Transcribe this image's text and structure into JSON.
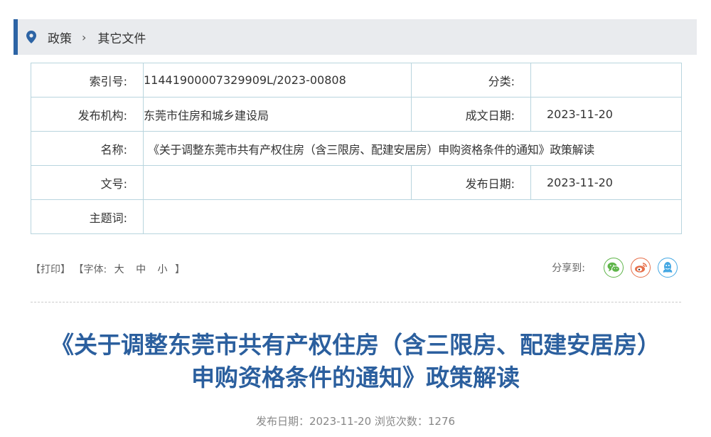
{
  "breadcrumb": {
    "items": [
      "政策",
      "其它文件"
    ],
    "separator": "›"
  },
  "meta": {
    "index_label": "索引号:",
    "index_value": "11441900007329909L/2023-00808",
    "category_label": "分类:",
    "category_value": "",
    "publisher_label": "发布机构:",
    "publisher_value": "东莞市住房和城乡建设局",
    "written_date_label": "成文日期:",
    "written_date_value": "2023-11-20",
    "name_label": "名称:",
    "name_value": "《关于调整东莞市共有产权住房（含三限房、配建安居房）申购资格条件的通知》政策解读",
    "doc_no_label": "文号:",
    "doc_no_value": "",
    "publish_date_label": "发布日期:",
    "publish_date_value": "2023-11-20",
    "subject_label": "主题词:",
    "subject_value": ""
  },
  "toolbar": {
    "print": "【打印】",
    "font_prefix": "【字体:",
    "font_large": "大",
    "font_medium": "中",
    "font_small": "小",
    "font_suffix": "】",
    "share_label": "分享到:",
    "share_icons": [
      "wechat-icon",
      "weibo-icon",
      "qq-icon"
    ]
  },
  "article": {
    "title": "《关于调整东莞市共有产权住房（含三限房、配建安居房）申购资格条件的通知》政策解读",
    "publish_info": "发布日期：2023-11-20  浏览次数：1276"
  },
  "colors": {
    "accent": "#2d64a5",
    "title": "#2b5f9e",
    "table_border": "#b9d5de",
    "wechat": "#5fb54a",
    "weibo": "#e6704b",
    "qq": "#45a8e3"
  }
}
